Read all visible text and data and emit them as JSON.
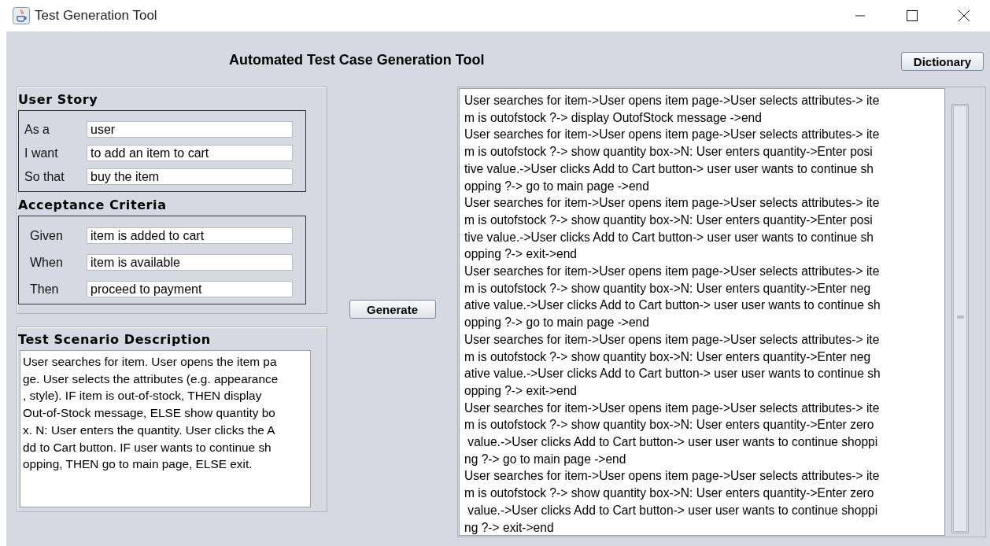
{
  "window": {
    "title": "Test Generation Tool"
  },
  "header": {
    "title": "Automated Test Case Generation Tool",
    "dictionary_button": "Dictionary"
  },
  "user_story": {
    "title": "User Story",
    "fields": [
      {
        "label": "As a",
        "value": "user"
      },
      {
        "label": "I want",
        "value": "to add an item to cart"
      },
      {
        "label": "So that",
        "value": "buy the item"
      }
    ]
  },
  "acceptance_criteria": {
    "title": "Acceptance Criteria",
    "fields": [
      {
        "label": "Given",
        "value": "item is added to cart"
      },
      {
        "label": "When",
        "value": "item is available"
      },
      {
        "label": "Then",
        "value": "proceed to payment"
      }
    ]
  },
  "scenario": {
    "title": "Test Scenario Description",
    "lines": [
      "User searches for item. User opens the item pa",
      "ge. User selects the attributes (e.g. appearance",
      ", style). IF item is out-of-stock, THEN display",
      "Out-of-Stock message, ELSE show quantity bo",
      "x. N: User enters the quantity. User clicks the A",
      "dd to Cart button. IF user wants to continue sh",
      "opping, THEN go to main page, ELSE exit."
    ]
  },
  "generate_button": "Generate",
  "output": {
    "lines": [
      "User searches for item->User opens item page->User selects attributes-> ite",
      "m is outofstock ?-> display OutofStock message ->end",
      "User searches for item->User opens item page->User selects attributes-> ite",
      "m is outofstock ?-> show quantity box->N: User enters quantity->Enter posi",
      "tive value.->User clicks Add to Cart button-> user user wants to continue sh",
      "opping ?-> go to main page ->end",
      "User searches for item->User opens item page->User selects attributes-> ite",
      "m is outofstock ?-> show quantity box->N: User enters quantity->Enter posi",
      "tive value.->User clicks Add to Cart button-> user user wants to continue sh",
      "opping ?-> exit->end",
      "User searches for item->User opens item page->User selects attributes-> ite",
      "m is outofstock ?-> show quantity box->N: User enters quantity->Enter neg",
      "ative value.->User clicks Add to Cart button-> user user wants to continue sh",
      "opping ?-> go to main page ->end",
      "User searches for item->User opens item page->User selects attributes-> ite",
      "m is outofstock ?-> show quantity box->N: User enters quantity->Enter neg",
      "ative value.->User clicks Add to Cart button-> user user wants to continue sh",
      "opping ?-> exit->end",
      "User searches for item->User opens item page->User selects attributes-> ite",
      "m is outofstock ?-> show quantity box->N: User enters quantity->Enter zero",
      " value.->User clicks Add to Cart button-> user user wants to continue shoppi",
      "ng ?-> go to main page ->end",
      "User searches for item->User opens item page->User selects attributes-> ite",
      "m is outofstock ?-> show quantity box->N: User enters quantity->Enter zero",
      " value.->User clicks Add to Cart button-> user user wants to continue shoppi",
      "ng ?-> exit->end"
    ]
  }
}
